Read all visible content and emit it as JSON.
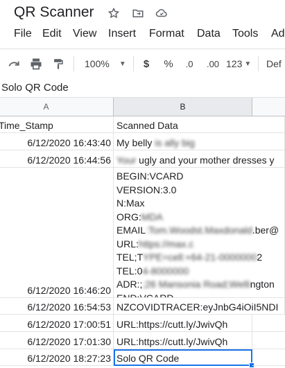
{
  "doc": {
    "title": "QR Scanner"
  },
  "menu": [
    "File",
    "Edit",
    "View",
    "Insert",
    "Format",
    "Data",
    "Tools",
    "Ad"
  ],
  "toolbar": {
    "zoom": "100%",
    "currency": "$",
    "percent": "%",
    "dec_decrease": ".0",
    "dec_increase": ".00",
    "more_formats": "123",
    "font": "Def"
  },
  "formula_bar": {
    "value": "Solo QR Code"
  },
  "columns": [
    "A",
    "B"
  ],
  "header_row": {
    "a": "Time_Stamp",
    "b": "Scanned Data"
  },
  "rows": [
    {
      "timestamp": "6/12/2020 16:43:40",
      "data": "My belly "
    },
    {
      "timestamp": "6/12/2020 16:44:56",
      "data": " ugly and your mother dresses y"
    },
    {
      "timestamp": "6/12/2020 16:46:20",
      "lines": [
        "BEGIN:VCARD",
        "VERSION:3.0",
        "N:Max",
        "ORG:",
        "EMAIL",
        "URL:",
        "TEL;T",
        "TEL:0",
        "ADR:;",
        "END:VCARD"
      ]
    },
    {
      "timestamp": "6/12/2020 16:54:53",
      "data": "NZCOVIDTRACER:eyJnbG4iOiI5NDI"
    },
    {
      "timestamp": "6/12/2020 17:00:51",
      "data": "URL:https://cutt.ly/JwivQh"
    },
    {
      "timestamp": "6/12/2020 17:01:30",
      "data": "URL:https://cutt.ly/JwivQh"
    },
    {
      "timestamp": "6/12/2020 18:27:23",
      "data": "Solo QR Code"
    }
  ]
}
